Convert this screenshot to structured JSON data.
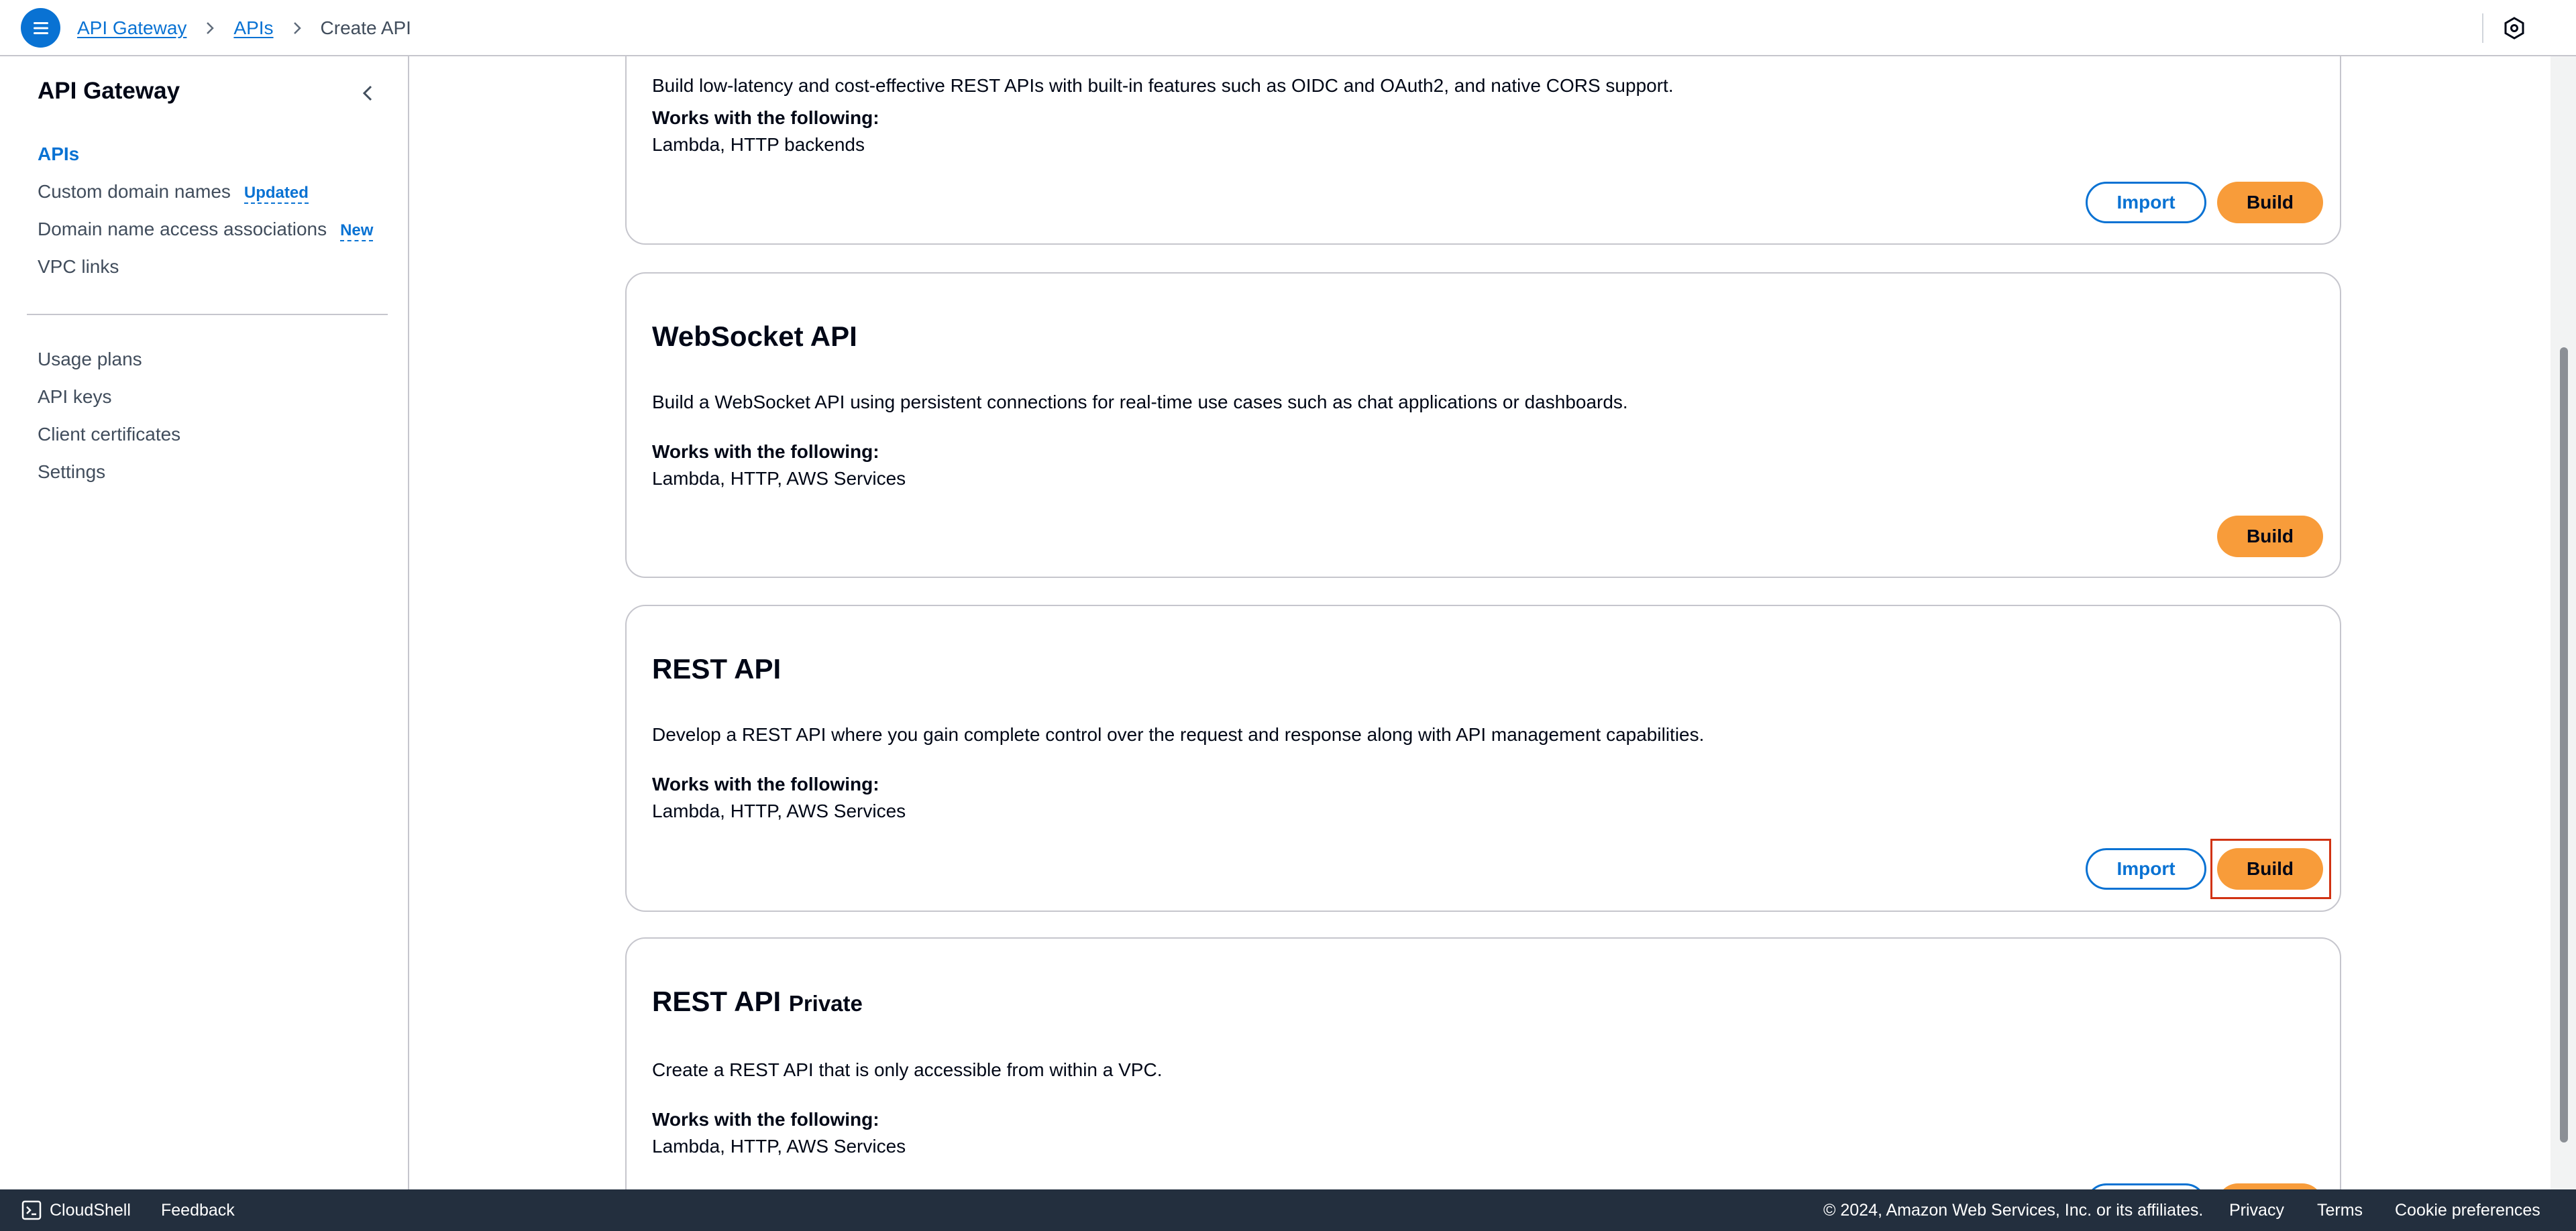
{
  "header": {
    "breadcrumbs": [
      "API Gateway",
      "APIs",
      "Create API"
    ]
  },
  "sidebar": {
    "title": "API Gateway",
    "items": [
      {
        "label": "APIs",
        "badge": ""
      },
      {
        "label": "Custom domain names",
        "badge": "Updated"
      },
      {
        "label": "Domain name access associations",
        "badge": "New"
      },
      {
        "label": "VPC links",
        "badge": ""
      }
    ],
    "items2": [
      {
        "label": "Usage plans"
      },
      {
        "label": "API keys"
      },
      {
        "label": "Client certificates"
      },
      {
        "label": "Settings"
      }
    ]
  },
  "cards": [
    {
      "title": "",
      "description": "Build low-latency and cost-effective REST APIs with built-in features such as OIDC and OAuth2, and native CORS support.",
      "works_label": "Works with the following:",
      "works_list": "Lambda, HTTP backends",
      "import_label": "Import",
      "build_label": "Build"
    },
    {
      "title": "WebSocket API",
      "description": "Build a WebSocket API using persistent connections for real-time use cases such as chat applications or dashboards.",
      "works_label": "Works with the following:",
      "works_list": "Lambda, HTTP, AWS Services",
      "build_label": "Build"
    },
    {
      "title": "REST API",
      "description": "Develop a REST API where you gain complete control over the request and response along with API management capabilities.",
      "works_label": "Works with the following:",
      "works_list": "Lambda, HTTP, AWS Services",
      "import_label": "Import",
      "build_label": "Build"
    },
    {
      "title": "REST API",
      "title_suffix": "Private",
      "description": "Create a REST API that is only accessible from within a VPC.",
      "works_label": "Works with the following:",
      "works_list": "Lambda, HTTP, AWS Services"
    }
  ],
  "footer": {
    "cloudshell": "CloudShell",
    "feedback": "Feedback",
    "copyright": "© 2024, Amazon Web Services, Inc. or its affiliates.",
    "privacy": "Privacy",
    "terms": "Terms",
    "cookies": "Cookie preferences"
  },
  "colors": {
    "link_blue": "#0972d3",
    "build_orange": "#f89c3a",
    "highlight_red": "#d13212",
    "footer_bg": "#232f3e"
  }
}
